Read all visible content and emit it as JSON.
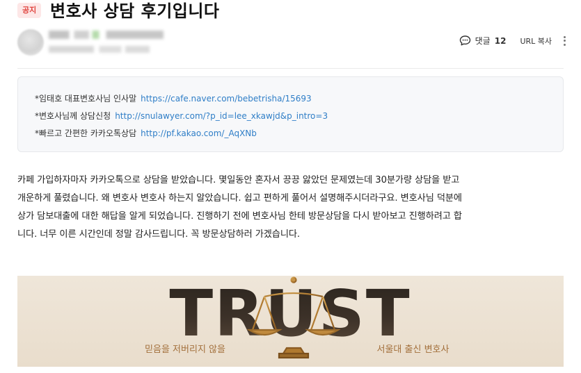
{
  "post": {
    "badge": "공지",
    "title": "변호사 상담 후기입니다"
  },
  "actions": {
    "comment_label": "댓글",
    "comment_count": "12",
    "url_copy": "URL 복사"
  },
  "info_box": {
    "lines": [
      {
        "label": "*임태호 대표변호사님 인사말",
        "url": "https://cafe.naver.com/bebetrisha/15693"
      },
      {
        "label": "*변호사님께 상담신청",
        "url": "http://snulawyer.com/?p_id=lee_xkawjd&p_intro=3"
      },
      {
        "label": "*빠르고 간편한 카카오톡상담",
        "url": "http://pf.kakao.com/_AqXNb"
      }
    ]
  },
  "body": {
    "lines": [
      "카페 가입하자마자 카카오톡으로 상담을 받았습니다. 몇일동안 혼자서 끙끙 앓았던 문제였는데 30분가량 상담을 받고",
      "개운하게 풀렸습니다. 왜 변호사 변호사 하는지 알았습니다. 쉽고 편하게 풀어서 설명해주시더라구요. 변호사님 덕분에",
      "상가 담보대출에 대한 해답을 알게 되었습니다. 진행하기 전에 변호사님 한테 방문상담을 다시 받아보고 진행하려고 합",
      "니다. 너무 이른 시간인데 정말 감사드립니다. 꼭 방문상담하러 가겠습니다."
    ]
  },
  "banner": {
    "word": "TRUST",
    "left_text": "믿음을 저버리지 않을",
    "right_text": "서울대 출신 변호사",
    "accent": "#a3703c"
  },
  "icons": {
    "comment": "speech-bubble-icon",
    "more": "more-vertical-icon",
    "scale": "justice-scale-icon"
  }
}
